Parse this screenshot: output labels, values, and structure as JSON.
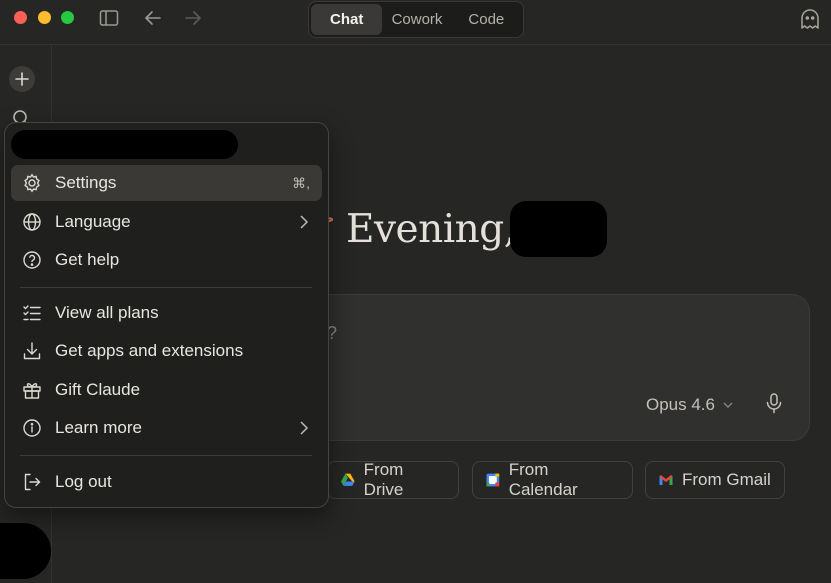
{
  "modes": [
    {
      "label": "Chat",
      "active": true
    },
    {
      "label": "Cowork",
      "active": false
    },
    {
      "label": "Code",
      "active": false
    }
  ],
  "greeting": {
    "text": "Evening,"
  },
  "composer": {
    "placeholder": "?",
    "model": "Opus 4.6"
  },
  "chips": [
    {
      "label": "From Drive",
      "icon": "google-drive-icon"
    },
    {
      "label": "From Calendar",
      "icon": "google-calendar-icon"
    },
    {
      "label": "From Gmail",
      "icon": "gmail-icon"
    }
  ],
  "menu": {
    "items": [
      {
        "label": "Settings",
        "icon": "gear-icon",
        "shortcut": "⌘,"
      },
      {
        "label": "Language",
        "icon": "globe-icon"
      },
      {
        "label": "Get help",
        "icon": "help-circle-icon"
      },
      {
        "label": "View all plans",
        "icon": "list-check-icon"
      },
      {
        "label": "Get apps and extensions",
        "icon": "download-icon"
      },
      {
        "label": "Gift Claude",
        "icon": "gift-icon"
      },
      {
        "label": "Learn more",
        "icon": "info-circle-icon"
      },
      {
        "label": "Log out",
        "icon": "logout-icon"
      }
    ]
  },
  "colors": {
    "background": "#262624",
    "menu_background": "#1f1f1d",
    "hover": "#3a3936",
    "accent": "#d97757"
  }
}
